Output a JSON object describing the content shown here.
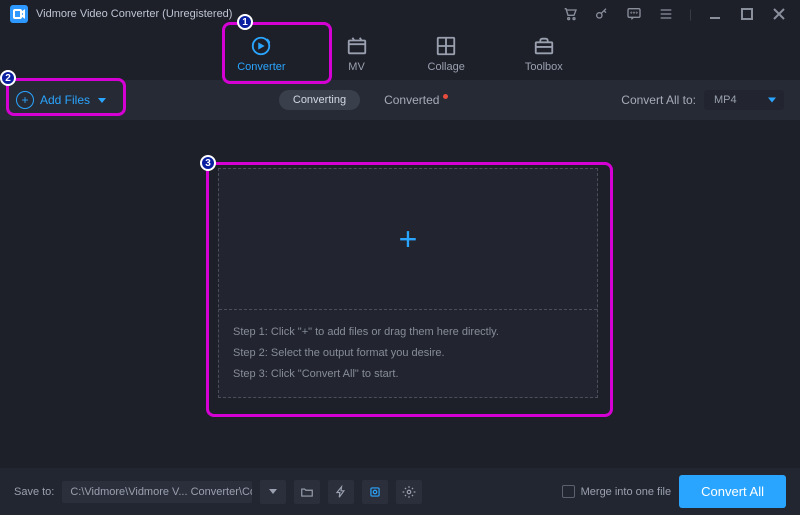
{
  "title": "Vidmore Video Converter (Unregistered)",
  "nav": {
    "converter": "Converter",
    "mv": "MV",
    "collage": "Collage",
    "toolbox": "Toolbox"
  },
  "subbar": {
    "add_files": "Add Files",
    "converting": "Converting",
    "converted": "Converted",
    "convert_all_to": "Convert All to:",
    "format": "MP4"
  },
  "dropzone": {
    "step1": "Step 1: Click \"+\" to add files or drag them here directly.",
    "step2": "Step 2: Select the output format you desire.",
    "step3": "Step 3: Click \"Convert All\" to start."
  },
  "footer": {
    "save_to": "Save to:",
    "path": "C:\\Vidmore\\Vidmore V... Converter\\Converted",
    "merge": "Merge into one file",
    "convert_all": "Convert All"
  },
  "annotations": {
    "a1": "1",
    "a2": "2",
    "a3": "3"
  }
}
